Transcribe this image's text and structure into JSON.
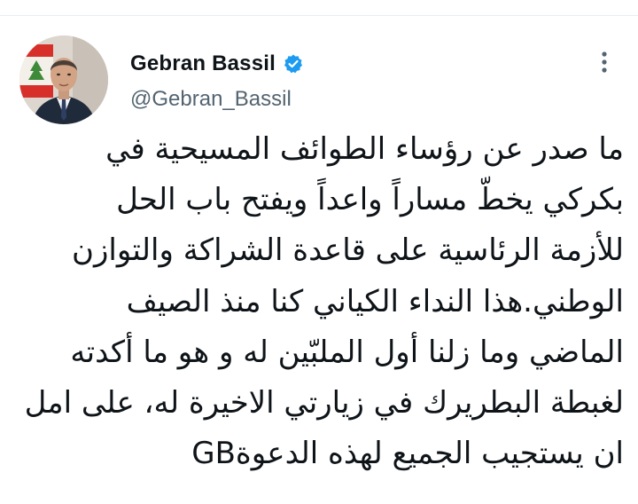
{
  "author": {
    "display_name": "Gebran Bassil",
    "handle": "@Gebran_Bassil",
    "verified": true,
    "avatar_icon": "profile-photo",
    "verified_icon": "verified-badge-icon",
    "more_icon": "vertical-ellipsis-icon"
  },
  "tweet": {
    "lines": [
      "ما صدر عن رؤساء الطوائف المسيحية في",
      "بكركي يخطّ مساراً واعداً ويفتح باب الحل",
      "للأزمة الرئاسية على قاعدة الشراكة والتوازن",
      "الوطني.هذا النداء الكياني كنا منذ الصيف",
      "الماضي وما زلنا أول الملبّين له و هو ما أكدته",
      "لغبطة البطريرك في زيارتي الاخيرة له، على امل",
      "ان يستجيب الجميع لهذه الدعوةGB"
    ]
  },
  "colors": {
    "text": "#0f1419",
    "secondary_text": "#536471",
    "verified": "#1d9bf0",
    "divider": "#e6ecf0"
  }
}
